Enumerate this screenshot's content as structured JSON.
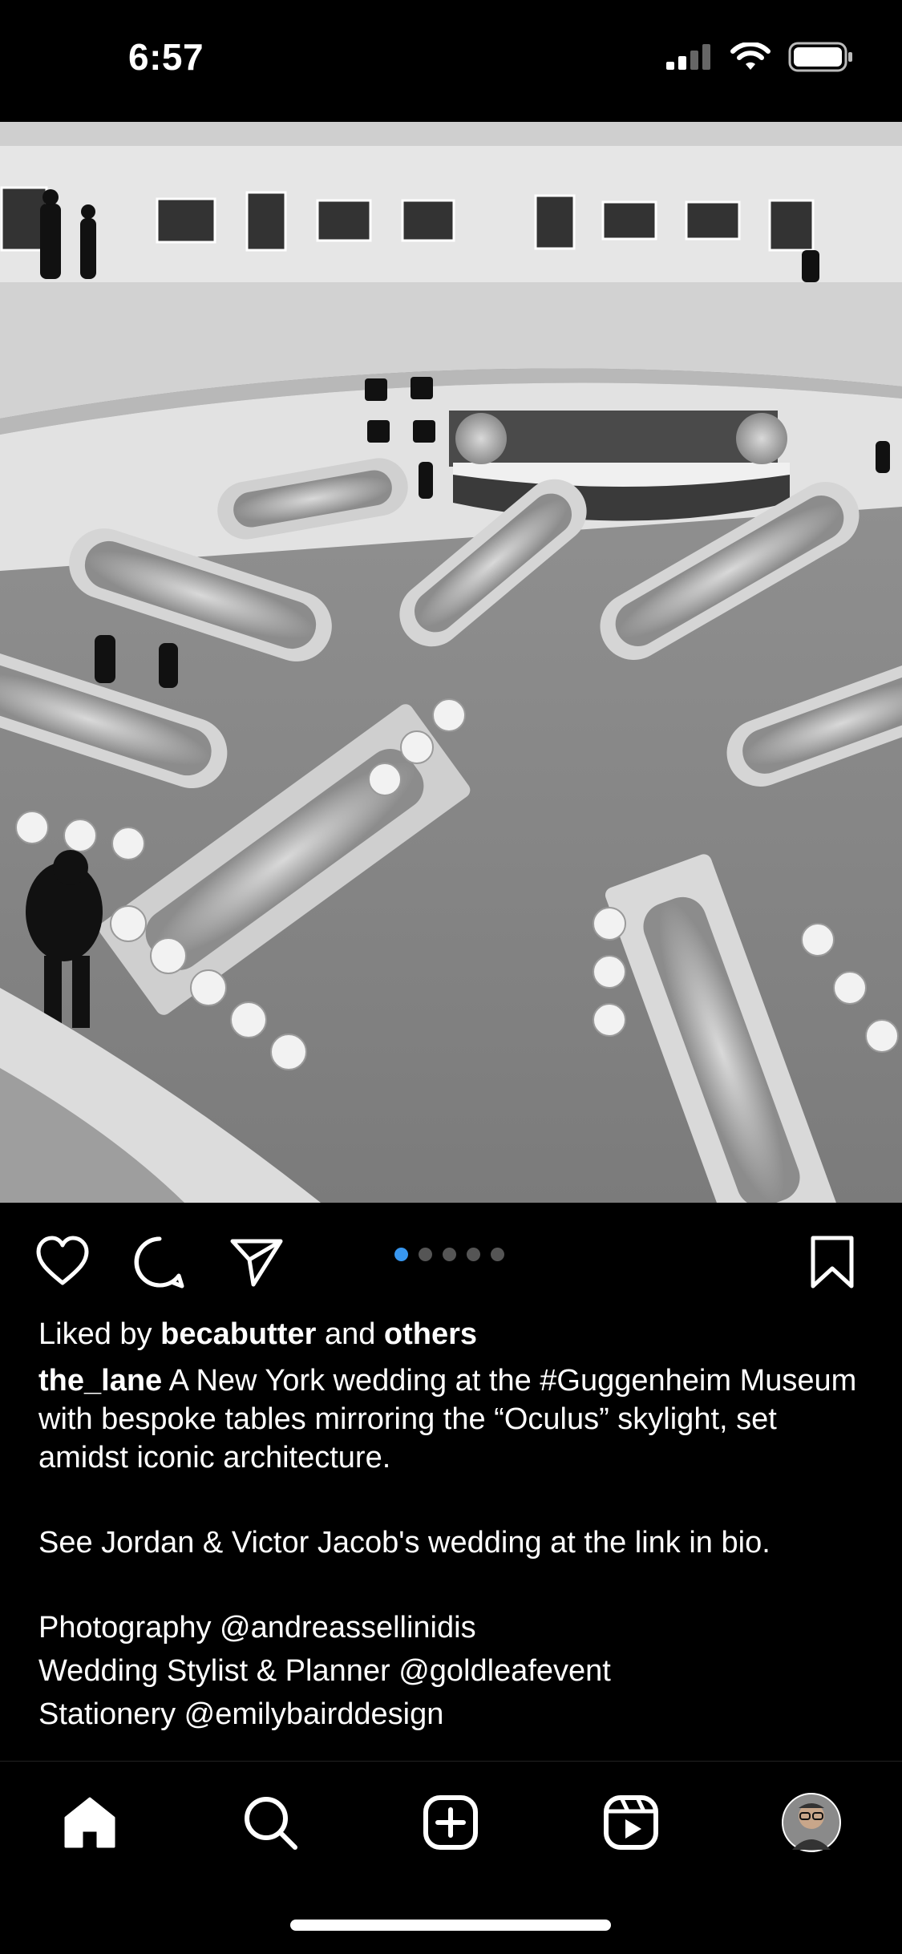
{
  "status_bar": {
    "time": "6:57"
  },
  "post": {
    "image_alt": "Black and white photo of a banquet set up inside the Guggenheim Museum rotunda",
    "carousel": {
      "total": 5,
      "active_index": 0
    }
  },
  "likes": {
    "prefix": "Liked by",
    "user": "becabutter",
    "middle": "and",
    "others": "others"
  },
  "caption": {
    "username": "the_lane",
    "text": "A New York wedding at the #Guggenheim Museum with bespoke tables mirroring the “Oculus” skylight, set amidst iconic architecture.",
    "paragraph2": "See Jordan & Victor Jacob's wedding at the link in bio.",
    "line3": "Photography @andreassellinidis",
    "line4": "Wedding Stylist & Planner @goldleafevent",
    "line5": "Stationery @emilybairddesign"
  },
  "icons": {
    "like": "heart-icon",
    "comment": "comment-icon",
    "share": "paper-plane-icon",
    "save": "bookmark-icon",
    "home": "home-icon",
    "search": "search-icon",
    "create": "plus-square-icon",
    "reels": "reels-icon",
    "profile": "avatar"
  },
  "colors": {
    "background": "#000000",
    "text": "#ffffff",
    "carousel_active": "#3897f0"
  }
}
